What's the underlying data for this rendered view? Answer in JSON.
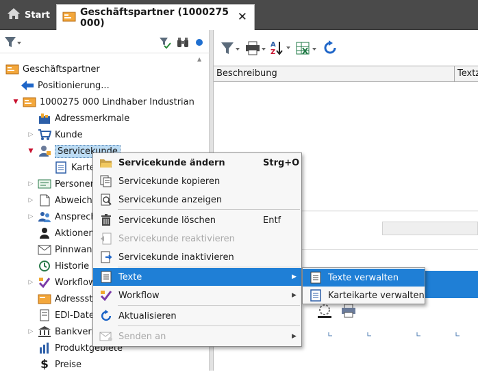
{
  "tabs": {
    "start_label": "Start",
    "active_label": "Geschäftspartner (1000275 000)",
    "close_glyph": "✕"
  },
  "tree": {
    "root": "Geschäftspartner",
    "positioning": "Positionierung...",
    "partner": "1000275  000  Lindhaber Industrian",
    "items": [
      {
        "label": "Adressmerkmale",
        "icon": "address-features-icon"
      },
      {
        "label": "Kunde",
        "icon": "cart-icon"
      },
      {
        "label": "Servicekunde",
        "icon": "service-customer-icon"
      },
      {
        "label": "Kartei",
        "icon": "card-index-icon"
      },
      {
        "label": "Personen",
        "icon": "persons-icon"
      },
      {
        "label": "Abweiche",
        "icon": "deviating-address-icon"
      },
      {
        "label": "Ansprech",
        "icon": "contact-persons-icon"
      },
      {
        "label": "Aktionen",
        "icon": "actions-icon"
      },
      {
        "label": "Pinnwand",
        "icon": "pinboard-icon"
      },
      {
        "label": "Historie",
        "icon": "history-icon"
      },
      {
        "label": "Workflow",
        "icon": "workflow-icon"
      },
      {
        "label": "Adressstr",
        "icon": "address-structure-icon"
      },
      {
        "label": "EDI-Date",
        "icon": "edi-data-icon"
      },
      {
        "label": "Bankverb",
        "icon": "bank-icon"
      },
      {
        "label": "Produktgebiete",
        "icon": "product-areas-icon"
      },
      {
        "label": "Preise",
        "icon": "prices-icon"
      }
    ]
  },
  "grid": {
    "columns": [
      "Beschreibung",
      "Textz"
    ]
  },
  "context_menu": {
    "items": [
      {
        "label": "Servicekunde ändern",
        "shortcut": "Strg+O"
      },
      {
        "label": "Servicekunde kopieren",
        "shortcut": ""
      },
      {
        "label": "Servicekunde anzeigen",
        "shortcut": ""
      },
      {
        "label": "Servicekunde löschen",
        "shortcut": "Entf"
      },
      {
        "label": "Servicekunde reaktivieren",
        "shortcut": ""
      },
      {
        "label": "Servicekunde inaktivieren",
        "shortcut": ""
      },
      {
        "label": "Texte",
        "shortcut": ""
      },
      {
        "label": "Workflow",
        "shortcut": ""
      },
      {
        "label": "Aktualisieren",
        "shortcut": ""
      },
      {
        "label": "Senden an",
        "shortcut": ""
      }
    ]
  },
  "submenu": {
    "items": [
      {
        "label": "Texte verwalten"
      },
      {
        "label": "Karteikarte verwalten"
      }
    ]
  },
  "colors": {
    "accent_blue": "#1f7fd6",
    "selection_blue": "#bcdcf4",
    "tab_bar": "#4a4a4a",
    "expand_red": "#c8102e"
  }
}
